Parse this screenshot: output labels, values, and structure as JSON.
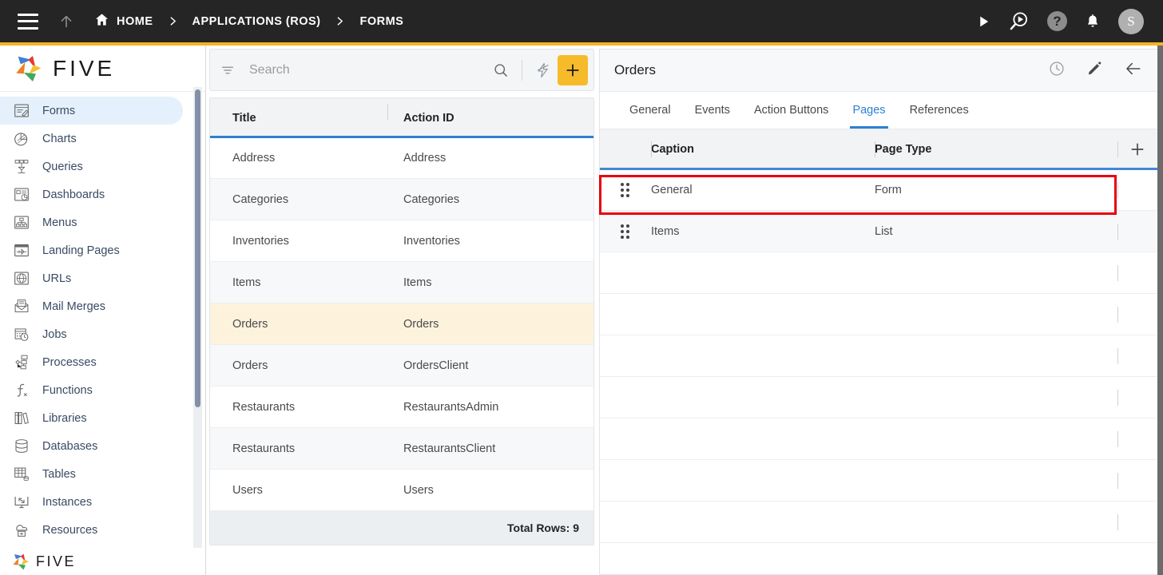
{
  "topbar": {
    "menu_icon": "hamburger-icon",
    "up_icon": "arrow-up-icon",
    "breadcrumbs": [
      {
        "label": "HOME",
        "icon": "home-icon"
      },
      {
        "label": "APPLICATIONS (ROS)",
        "icon": ""
      },
      {
        "label": "FORMS",
        "icon": ""
      }
    ],
    "separator": "›",
    "actions": [
      {
        "name": "run-icon",
        "glyph": "▶"
      },
      {
        "name": "debug-run-icon",
        "glyph": "search-play"
      },
      {
        "name": "help-icon",
        "glyph": "?"
      },
      {
        "name": "notifications-bell-icon",
        "glyph": "🔔"
      }
    ],
    "avatar_initial": "S",
    "accent_color": "#f5b325"
  },
  "sidebar": {
    "logo_text": "FIVE",
    "footer_logo_text": "FIVE",
    "items": [
      {
        "label": "Forms",
        "icon": "forms-icon",
        "active": true
      },
      {
        "label": "Charts",
        "icon": "charts-icon",
        "active": false
      },
      {
        "label": "Queries",
        "icon": "queries-icon",
        "active": false
      },
      {
        "label": "Dashboards",
        "icon": "dashboards-icon",
        "active": false
      },
      {
        "label": "Menus",
        "icon": "menus-icon",
        "active": false
      },
      {
        "label": "Landing Pages",
        "icon": "landing-pages-icon",
        "active": false
      },
      {
        "label": "URLs",
        "icon": "urls-icon",
        "active": false
      },
      {
        "label": "Mail Merges",
        "icon": "mail-merges-icon",
        "active": false
      },
      {
        "label": "Jobs",
        "icon": "jobs-icon",
        "active": false
      },
      {
        "label": "Processes",
        "icon": "processes-icon",
        "active": false
      },
      {
        "label": "Functions",
        "icon": "functions-icon",
        "active": false
      },
      {
        "label": "Libraries",
        "icon": "libraries-icon",
        "active": false
      },
      {
        "label": "Databases",
        "icon": "databases-icon",
        "active": false
      },
      {
        "label": "Tables",
        "icon": "tables-icon",
        "active": false
      },
      {
        "label": "Instances",
        "icon": "instances-icon",
        "active": false
      },
      {
        "label": "Resources",
        "icon": "resources-icon",
        "active": false
      }
    ]
  },
  "list_panel": {
    "search": {
      "placeholder": "Search",
      "value": ""
    },
    "filter_icon": "filter-icon",
    "search_icon": "search-icon",
    "quick_action_icon": "lightning-bolt-icon",
    "add_icon": "plus-icon",
    "columns": [
      "Title",
      "Action ID"
    ],
    "rows": [
      {
        "title": "Address",
        "action_id": "Address",
        "selected": false
      },
      {
        "title": "Categories",
        "action_id": "Categories",
        "selected": false
      },
      {
        "title": "Inventories",
        "action_id": "Inventories",
        "selected": false
      },
      {
        "title": "Items",
        "action_id": "Items",
        "selected": false
      },
      {
        "title": "Orders",
        "action_id": "Orders",
        "selected": true
      },
      {
        "title": "Orders",
        "action_id": "OrdersClient",
        "selected": false
      },
      {
        "title": "Restaurants",
        "action_id": "RestaurantsAdmin",
        "selected": false
      },
      {
        "title": "Restaurants",
        "action_id": "RestaurantsClient",
        "selected": false
      },
      {
        "title": "Users",
        "action_id": "Users",
        "selected": false
      }
    ],
    "footer_text": "Total Rows: 9"
  },
  "detail_panel": {
    "title": "Orders",
    "header_icons": [
      {
        "name": "history-clock-icon"
      },
      {
        "name": "edit-pencil-icon"
      },
      {
        "name": "back-arrow-icon"
      }
    ],
    "tabs": [
      {
        "label": "General",
        "active": false
      },
      {
        "label": "Events",
        "active": false
      },
      {
        "label": "Action Buttons",
        "active": false
      },
      {
        "label": "Pages",
        "active": true
      },
      {
        "label": "References",
        "active": false
      }
    ],
    "grid": {
      "columns": [
        "Caption",
        "Page Type"
      ],
      "add_icon": "plus-icon",
      "rows": [
        {
          "caption": "General",
          "page_type": "Form",
          "drag_handle": "drag-handle-icon",
          "highlighted": true
        },
        {
          "caption": "Items",
          "page_type": "List",
          "drag_handle": "drag-handle-icon",
          "highlighted": false
        }
      ]
    }
  },
  "annotation": {
    "color": "#e8000d",
    "target": "General row"
  }
}
